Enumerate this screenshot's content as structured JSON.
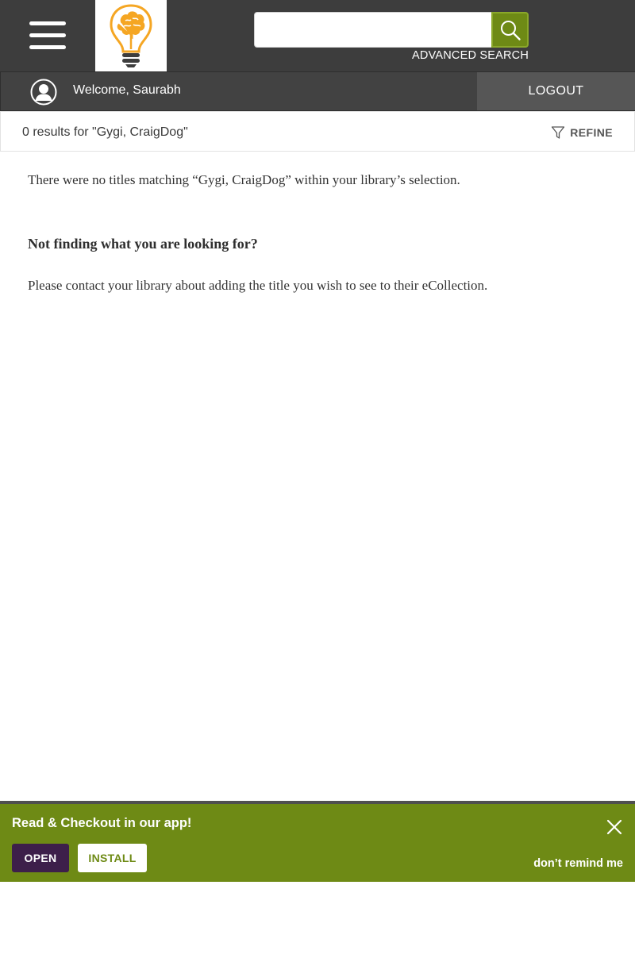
{
  "header": {
    "menu_icon": "hamburger-icon",
    "logo_icon": "lightbulb-brain-logo",
    "search": {
      "value": "",
      "placeholder": ""
    },
    "search_icon": "search-icon",
    "advanced_search_label": "ADVANCED SEARCH"
  },
  "userbar": {
    "user_icon": "user-icon",
    "welcome_text": "Welcome, Saurabh",
    "logout_label": "LOGOUT"
  },
  "results": {
    "summary": "0 results for \"Gygi, CraigDog\"",
    "refine_icon": "filter-icon",
    "refine_label": "REFINE"
  },
  "content": {
    "no_match_text": "There were no titles matching “Gygi, CraigDog” within your library’s selection.",
    "not_finding_heading": "Not finding what you are looking for?",
    "contact_text": "Please contact your library about adding the title you wish to see to their eCollection."
  },
  "app_banner": {
    "title": "Read & Checkout in our app!",
    "close_icon": "close-icon",
    "open_label": "OPEN",
    "install_label": "INSTALL",
    "dont_remind_label": "don’t remind me"
  },
  "colors": {
    "topbar": "#3d3d3d",
    "accent_green": "#6e8a15",
    "open_button": "#3d1f4a",
    "logo_orange": "#f5a623"
  }
}
